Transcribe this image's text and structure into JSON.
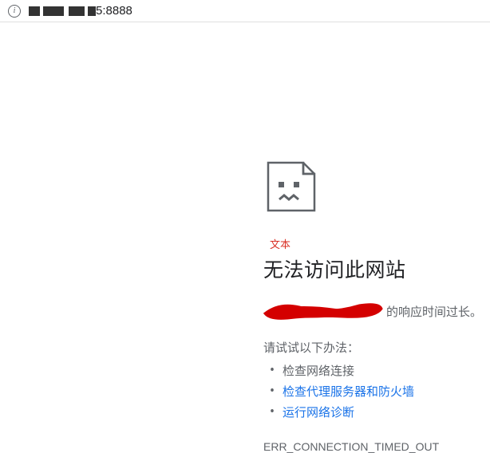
{
  "address_bar": {
    "visible_url_suffix": "5:8888"
  },
  "error": {
    "text_label": "文本",
    "title": "无法访问此网站",
    "response_suffix": "的响应时间过长。",
    "try_heading": "请试试以下办法：",
    "suggestions": {
      "check_network": "检查网络连接",
      "check_proxy_firewall": "检查代理服务器和防火墙",
      "run_diagnostics": "运行网络诊断"
    },
    "code": "ERR_CONNECTION_TIMED_OUT"
  }
}
